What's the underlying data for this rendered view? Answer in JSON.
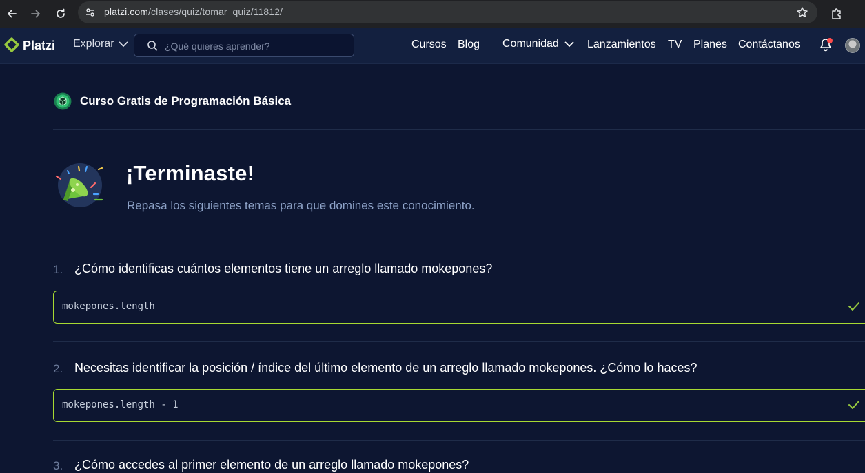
{
  "browser": {
    "url_host": "platzi.com",
    "url_path": "/clases/quiz/tomar_quiz/11812/"
  },
  "header": {
    "logo_text": "Platzi",
    "explorar_label": "Explorar",
    "search_placeholder": "¿Qué quieres aprender?",
    "nav": {
      "cursos": "Cursos",
      "blog": "Blog",
      "comunidad": "Comunidad",
      "lanzamientos": "Lanzamientos",
      "tv": "TV",
      "planes": "Planes",
      "contactanos": "Contáctanos"
    }
  },
  "course": {
    "title": "Curso Gratis de Programación Básica"
  },
  "result": {
    "title": "¡Terminaste!",
    "subtitle": "Repasa los siguientes temas para que domines este conocimiento."
  },
  "questions": [
    {
      "number": "1.",
      "text": "¿Cómo identificas cuántos elementos tiene un arreglo llamado mokepones?",
      "answer": "mokepones.length"
    },
    {
      "number": "2.",
      "text": "Necesitas identificar la posición / índice del último elemento de un arreglo llamado mokepones. ¿Cómo lo haces?",
      "answer": "mokepones.length - 1"
    },
    {
      "number": "3.",
      "text": "¿Cómo accedes al primer elemento de un arreglo llamado mokepones?"
    }
  ],
  "colors": {
    "background": "#0d1631",
    "header_bg": "#13203f",
    "accent_green": "#98ca3f",
    "answer_border": "#a7d932",
    "subtitle": "#8ea3c8"
  }
}
